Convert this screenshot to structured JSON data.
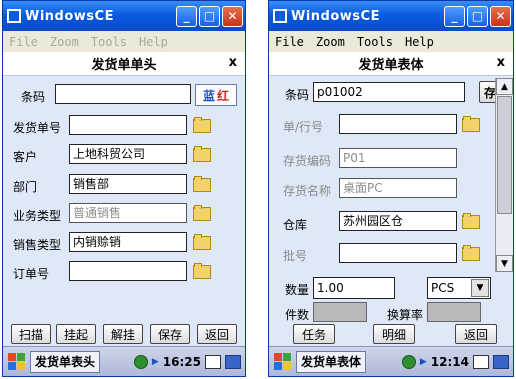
{
  "left": {
    "window_title": "WindowsCE",
    "menu": [
      "File",
      "Zoom",
      "Tools",
      "Help"
    ],
    "header": "发货单单头",
    "header_close": "x",
    "barcode_label": "条码",
    "barcode_value": "",
    "color_tag_blue": "蓝",
    "color_tag_red": "红",
    "fields": [
      {
        "label": "发货单号",
        "value": ""
      },
      {
        "label": "客户",
        "value": "上地科贸公司"
      },
      {
        "label": "部门",
        "value": "销售部"
      },
      {
        "label": "业务类型",
        "value": "普通销售"
      },
      {
        "label": "销售类型",
        "value": "内销赊销"
      },
      {
        "label": "订单号",
        "value": ""
      }
    ],
    "buttons": [
      "扫描",
      "挂起",
      "解挂",
      "保存",
      "返回"
    ],
    "taskbar_title": "发货单表头",
    "clock": "16:25"
  },
  "right": {
    "window_title": "WindowsCE",
    "menu": [
      "File",
      "Zoom",
      "Tools",
      "Help"
    ],
    "header": "发货单表体",
    "header_close": "x",
    "barcode_label": "条码",
    "barcode_value": "p01002",
    "save_button": "存",
    "fields": [
      {
        "label": "单/行号",
        "value": ""
      },
      {
        "label": "存货编码",
        "value": "P01"
      },
      {
        "label": "存货名称",
        "value": "桌面PC"
      },
      {
        "label": "仓库",
        "value": "苏州园区仓"
      },
      {
        "label": "批号",
        "value": ""
      }
    ],
    "qty_label": "数量",
    "qty_value": "1.00",
    "unit_value": "PCS",
    "pieces_label": "件数",
    "rate_label": "换算率",
    "buttons": [
      "任务",
      "明细",
      "返回"
    ],
    "taskbar_title": "发货单表体",
    "clock": "12:14"
  },
  "colors": {
    "titlebar": "#0a5be0",
    "client_bg": "#dfe8f7",
    "disabled_text": "#8a8a8a",
    "close_button": "#c5341b"
  }
}
